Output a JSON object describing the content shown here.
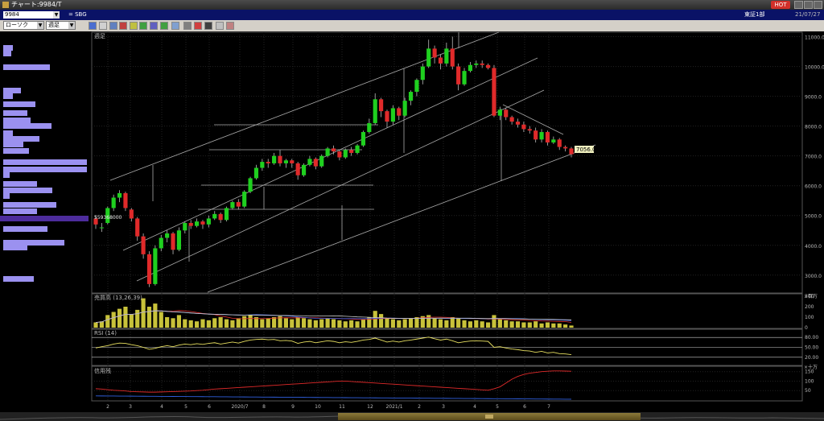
{
  "window": {
    "title": "チャート:9984/T",
    "hot_label": "HOT"
  },
  "symbol": {
    "code": "9984",
    "name": "= SBG",
    "market": "東証1部",
    "date": "21/07/27"
  },
  "toolbar": {
    "chart_type": "ローソク",
    "period": "週足"
  },
  "main_panel": {
    "label": "週足",
    "price_flag": "7056.0",
    "shares_label": "559368000"
  },
  "volume_panel": {
    "label": "売買高 (13,26,39)",
    "unit": "×百万",
    "ticks": [
      "300",
      "200",
      "100",
      "0"
    ]
  },
  "rsi_panel": {
    "label": "RSI (14)",
    "ticks": [
      "80.00",
      "50.00",
      "20.00"
    ]
  },
  "margin_panel": {
    "label": "信用残",
    "unit": "×十万",
    "ticks": [
      "150",
      "100",
      "50"
    ]
  },
  "colors": {
    "up": "#1fd01f",
    "down": "#e02a2a",
    "profile": "#9b91f0",
    "accent": "#d2302a"
  },
  "chart_data": {
    "type": "candlestick",
    "price_axis_ticks": [
      "11000.0",
      "10000.0",
      "9000.0",
      "8000.0",
      "7000.0",
      "6000.0",
      "5000.0",
      "4000.0",
      "3000.0"
    ],
    "x_tick_labels": [
      "2",
      "3",
      "4",
      "5",
      "6",
      "2020/7",
      "8",
      "9",
      "10",
      "11",
      "12",
      "2021/1",
      "2",
      "3",
      "4",
      "5",
      "6",
      "7"
    ],
    "candles": [
      [
        4900,
        4700,
        5000,
        4550
      ],
      [
        4600,
        4600,
        4750,
        4450
      ],
      [
        4750,
        5250,
        5300,
        4700
      ],
      [
        5250,
        5600,
        5700,
        5150
      ],
      [
        5600,
        5750,
        5850,
        5450
      ],
      [
        5750,
        5250,
        5800,
        5150
      ],
      [
        5200,
        4900,
        5250,
        4800
      ],
      [
        4900,
        4300,
        4950,
        4150
      ],
      [
        4300,
        3700,
        4400,
        3550
      ],
      [
        3700,
        2700,
        3800,
        2600
      ],
      [
        2700,
        3900,
        4000,
        2650
      ],
      [
        3900,
        4250,
        4350,
        3800
      ],
      [
        4250,
        4400,
        4500,
        4100
      ],
      [
        4400,
        3850,
        4450,
        3700
      ],
      [
        3850,
        4500,
        4600,
        3800
      ],
      [
        4500,
        4750,
        4800,
        4400
      ],
      [
        4750,
        4650,
        4850,
        4550
      ],
      [
        4650,
        4800,
        4900,
        4600
      ],
      [
        4800,
        4700,
        4850,
        4550
      ],
      [
        4700,
        4900,
        5000,
        4600
      ],
      [
        4900,
        5050,
        5150,
        4850
      ],
      [
        5050,
        4850,
        5100,
        4750
      ],
      [
        4850,
        5250,
        5300,
        4800
      ],
      [
        5250,
        5450,
        5500,
        5200
      ],
      [
        5450,
        5300,
        5550,
        5200
      ],
      [
        5300,
        5800,
        5850,
        5250
      ],
      [
        5800,
        6250,
        6300,
        5750
      ],
      [
        6250,
        6600,
        6700,
        6200
      ],
      [
        6600,
        6800,
        6900,
        6500
      ],
      [
        6800,
        6750,
        6900,
        6600
      ],
      [
        6750,
        7000,
        7100,
        6700
      ],
      [
        7000,
        6750,
        7200,
        6650
      ],
      [
        6750,
        6850,
        6900,
        6600
      ],
      [
        6850,
        6750,
        6900,
        6600
      ],
      [
        6750,
        6350,
        6800,
        6200
      ],
      [
        6350,
        6700,
        6750,
        6300
      ],
      [
        6700,
        6900,
        7000,
        6650
      ],
      [
        6900,
        6650,
        6950,
        6550
      ],
      [
        6650,
        7000,
        7050,
        6600
      ],
      [
        7000,
        7250,
        7300,
        6950
      ],
      [
        7250,
        7150,
        7350,
        7050
      ],
      [
        7150,
        6950,
        7200,
        6850
      ],
      [
        6950,
        7200,
        7250,
        6900
      ],
      [
        7200,
        7100,
        7300,
        7000
      ],
      [
        7100,
        7350,
        7400,
        7050
      ],
      [
        7350,
        7800,
        7850,
        7300
      ],
      [
        7800,
        8100,
        8250,
        7750
      ],
      [
        8100,
        8900,
        9100,
        8050
      ],
      [
        8900,
        8500,
        8950,
        8300
      ],
      [
        8500,
        8150,
        8550,
        7950
      ],
      [
        8150,
        8600,
        8700,
        8050
      ],
      [
        8600,
        8350,
        8650,
        8200
      ],
      [
        8350,
        8850,
        8950,
        8300
      ],
      [
        8850,
        9150,
        9200,
        8700
      ],
      [
        9150,
        9550,
        9600,
        9000
      ],
      [
        9550,
        10000,
        10100,
        9400
      ],
      [
        10000,
        10600,
        10900,
        9950
      ],
      [
        10600,
        10300,
        10700,
        10100
      ],
      [
        10300,
        10100,
        10400,
        9900
      ],
      [
        10100,
        10600,
        10800,
        10000
      ],
      [
        10600,
        10000,
        11000,
        9900
      ],
      [
        10000,
        9400,
        10100,
        9200
      ],
      [
        9400,
        9850,
        9950,
        9350
      ],
      [
        9850,
        10050,
        10150,
        9800
      ],
      [
        10050,
        10100,
        10200,
        9950
      ],
      [
        10100,
        10050,
        10200,
        9950
      ],
      [
        10050,
        9950,
        10100,
        9900
      ],
      [
        9950,
        8350,
        10050,
        8300
      ],
      [
        8350,
        8550,
        8650,
        8200
      ],
      [
        8550,
        8300,
        8600,
        8200
      ],
      [
        8300,
        8150,
        8350,
        8050
      ],
      [
        8150,
        8050,
        8250,
        7950
      ],
      [
        8050,
        7900,
        8150,
        7800
      ],
      [
        7900,
        7850,
        8000,
        7750
      ],
      [
        7850,
        7550,
        7950,
        7450
      ],
      [
        7550,
        7800,
        7900,
        7450
      ],
      [
        7800,
        7450,
        7850,
        7350
      ],
      [
        7450,
        7550,
        7650,
        7400
      ],
      [
        7550,
        7300,
        7600,
        7200
      ],
      [
        7300,
        7250,
        7350,
        7150
      ],
      [
        7250,
        7056,
        7300,
        6950
      ]
    ],
    "volume": [
      50,
      60,
      120,
      150,
      180,
      200,
      130,
      170,
      280,
      200,
      230,
      150,
      100,
      90,
      120,
      80,
      70,
      60,
      80,
      70,
      90,
      100,
      80,
      70,
      90,
      110,
      120,
      100,
      80,
      90,
      100,
      110,
      90,
      80,
      100,
      90,
      80,
      70,
      80,
      90,
      80,
      70,
      60,
      70,
      60,
      80,
      100,
      160,
      130,
      90,
      80,
      70,
      80,
      90,
      100,
      110,
      120,
      90,
      80,
      70,
      100,
      90,
      70,
      60,
      70,
      60,
      50,
      120,
      80,
      70,
      60,
      60,
      50,
      50,
      60,
      40,
      50,
      40,
      40,
      30,
      20
    ],
    "rsi": [
      48,
      52,
      55,
      60,
      63,
      62,
      58,
      55,
      50,
      44,
      47,
      52,
      55,
      52,
      57,
      60,
      58,
      61,
      59,
      62,
      64,
      60,
      63,
      66,
      63,
      68,
      72,
      74,
      75,
      73,
      74,
      70,
      71,
      69,
      62,
      66,
      68,
      64,
      67,
      70,
      68,
      64,
      67,
      65,
      68,
      72,
      74,
      78,
      72,
      66,
      69,
      66,
      70,
      72,
      75,
      78,
      81,
      76,
      72,
      75,
      70,
      64,
      67,
      69,
      70,
      69,
      68,
      50,
      52,
      48,
      45,
      43,
      40,
      39,
      35,
      38,
      33,
      35,
      31,
      30,
      28
    ],
    "margin": [
      60,
      58,
      55,
      52,
      50,
      48,
      45,
      44,
      43,
      42,
      42,
      43,
      44,
      45,
      46,
      47,
      48,
      50,
      52,
      55,
      58,
      60,
      62,
      64,
      66,
      68,
      70,
      72,
      74,
      76,
      78,
      80,
      82,
      84,
      86,
      88,
      90,
      92,
      94,
      96,
      98,
      100,
      100,
      98,
      96,
      94,
      92,
      90,
      88,
      86,
      84,
      82,
      80,
      78,
      76,
      74,
      72,
      70,
      68,
      66,
      64,
      62,
      60,
      58,
      56,
      54,
      52,
      60,
      70,
      90,
      110,
      125,
      135,
      142,
      146,
      150,
      152,
      154,
      154,
      153,
      152
    ],
    "volume_profile": [
      8,
      8,
      0,
      0,
      20,
      20,
      0,
      20,
      35,
      35,
      0,
      42,
      52,
      0,
      0,
      0,
      2,
      2
    ]
  }
}
